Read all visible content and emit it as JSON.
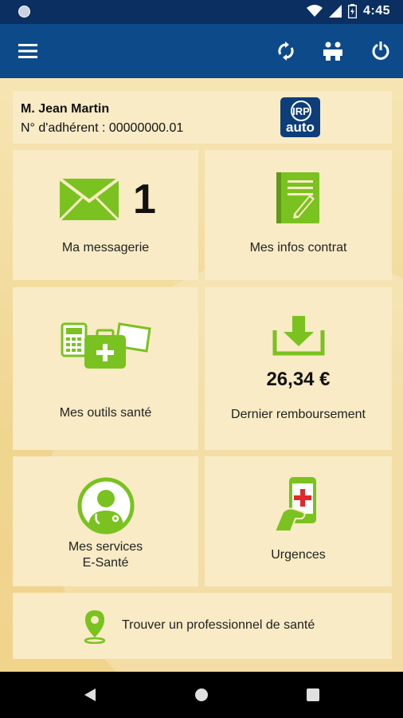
{
  "status_bar": {
    "time": "4:45"
  },
  "user": {
    "name": "M. Jean Martin",
    "member_id": "N° d'adhérent : 00000000.01"
  },
  "logo": {
    "text_top": "IRP",
    "text_bottom": "auto"
  },
  "tiles": {
    "messagerie": {
      "label": "Ma messagerie",
      "count": "1"
    },
    "contrat": {
      "label": "Mes infos contrat"
    },
    "outils": {
      "label": "Mes outils santé"
    },
    "remboursement": {
      "label": "Dernier remboursement",
      "amount": "26,34 €"
    },
    "services": {
      "label_line1": "Mes services",
      "label_line2": "E-Santé"
    },
    "urgences": {
      "label": "Urgences"
    },
    "trouver": {
      "label": "Trouver un professionnel de santé"
    }
  },
  "colors": {
    "primary": "#0d4a8a",
    "accent": "#7ac21f",
    "tile": "#f8ebc5",
    "background": "#f3dca0"
  },
  "icons": [
    "menu-icon",
    "sync-icon",
    "people-icon",
    "power-icon",
    "envelope-icon",
    "contract-icon",
    "health-tools-icon",
    "download-icon",
    "doctor-icon",
    "phone-emergency-icon",
    "location-pin-icon"
  ]
}
